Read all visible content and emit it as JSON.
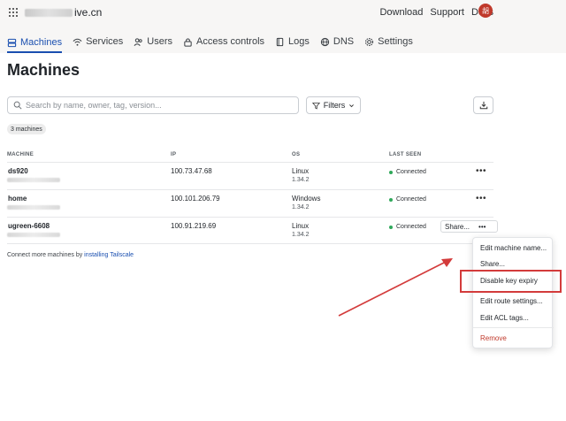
{
  "topbar": {
    "brand_suffix": "ive.cn",
    "links": [
      "Download",
      "Support",
      "Docs"
    ],
    "avatar_initials": "胡"
  },
  "tabs": [
    {
      "label": "Machines",
      "icon": "machines-icon",
      "active": true
    },
    {
      "label": "Services",
      "icon": "wifi-icon"
    },
    {
      "label": "Users",
      "icon": "users-icon"
    },
    {
      "label": "Access controls",
      "icon": "lock-icon"
    },
    {
      "label": "Logs",
      "icon": "book-icon"
    },
    {
      "label": "DNS",
      "icon": "globe-icon"
    },
    {
      "label": "Settings",
      "icon": "gear-icon"
    }
  ],
  "page": {
    "title": "Machines"
  },
  "search": {
    "placeholder": "Search by name, owner, tag, version..."
  },
  "filters": {
    "label": "Filters"
  },
  "machine_count": "3 machines",
  "table": {
    "headers": [
      "MACHINE",
      "IP",
      "OS",
      "LAST SEEN"
    ],
    "rows": [
      {
        "name": "ds920",
        "ip": "100.73.47.68",
        "os": "Linux",
        "version": "1.34.2",
        "last_seen": "Connected",
        "more": "•••"
      },
      {
        "name": "home",
        "ip": "100.101.206.79",
        "os": "Windows",
        "version": "1.34.2",
        "last_seen": "Connected",
        "more": "•••"
      },
      {
        "name": "ugreen-6608",
        "ip": "100.91.219.69",
        "os": "Linux",
        "version": "1.34.2",
        "last_seen": "Connected",
        "more": "•••",
        "share": "Share..."
      }
    ]
  },
  "connect_note": {
    "prefix": "Connect more machines by ",
    "link": "installing Tailscale"
  },
  "menu": {
    "items": [
      "Edit machine name...",
      "Share...",
      "Disable key expiry",
      "Edit route settings...",
      "Edit ACL tags..."
    ],
    "remove": "Remove"
  },
  "colors": {
    "accent": "#1a4fb0",
    "annotation": "#d33b3b",
    "status_ok": "#2fa85a",
    "danger": "#c0392b"
  }
}
